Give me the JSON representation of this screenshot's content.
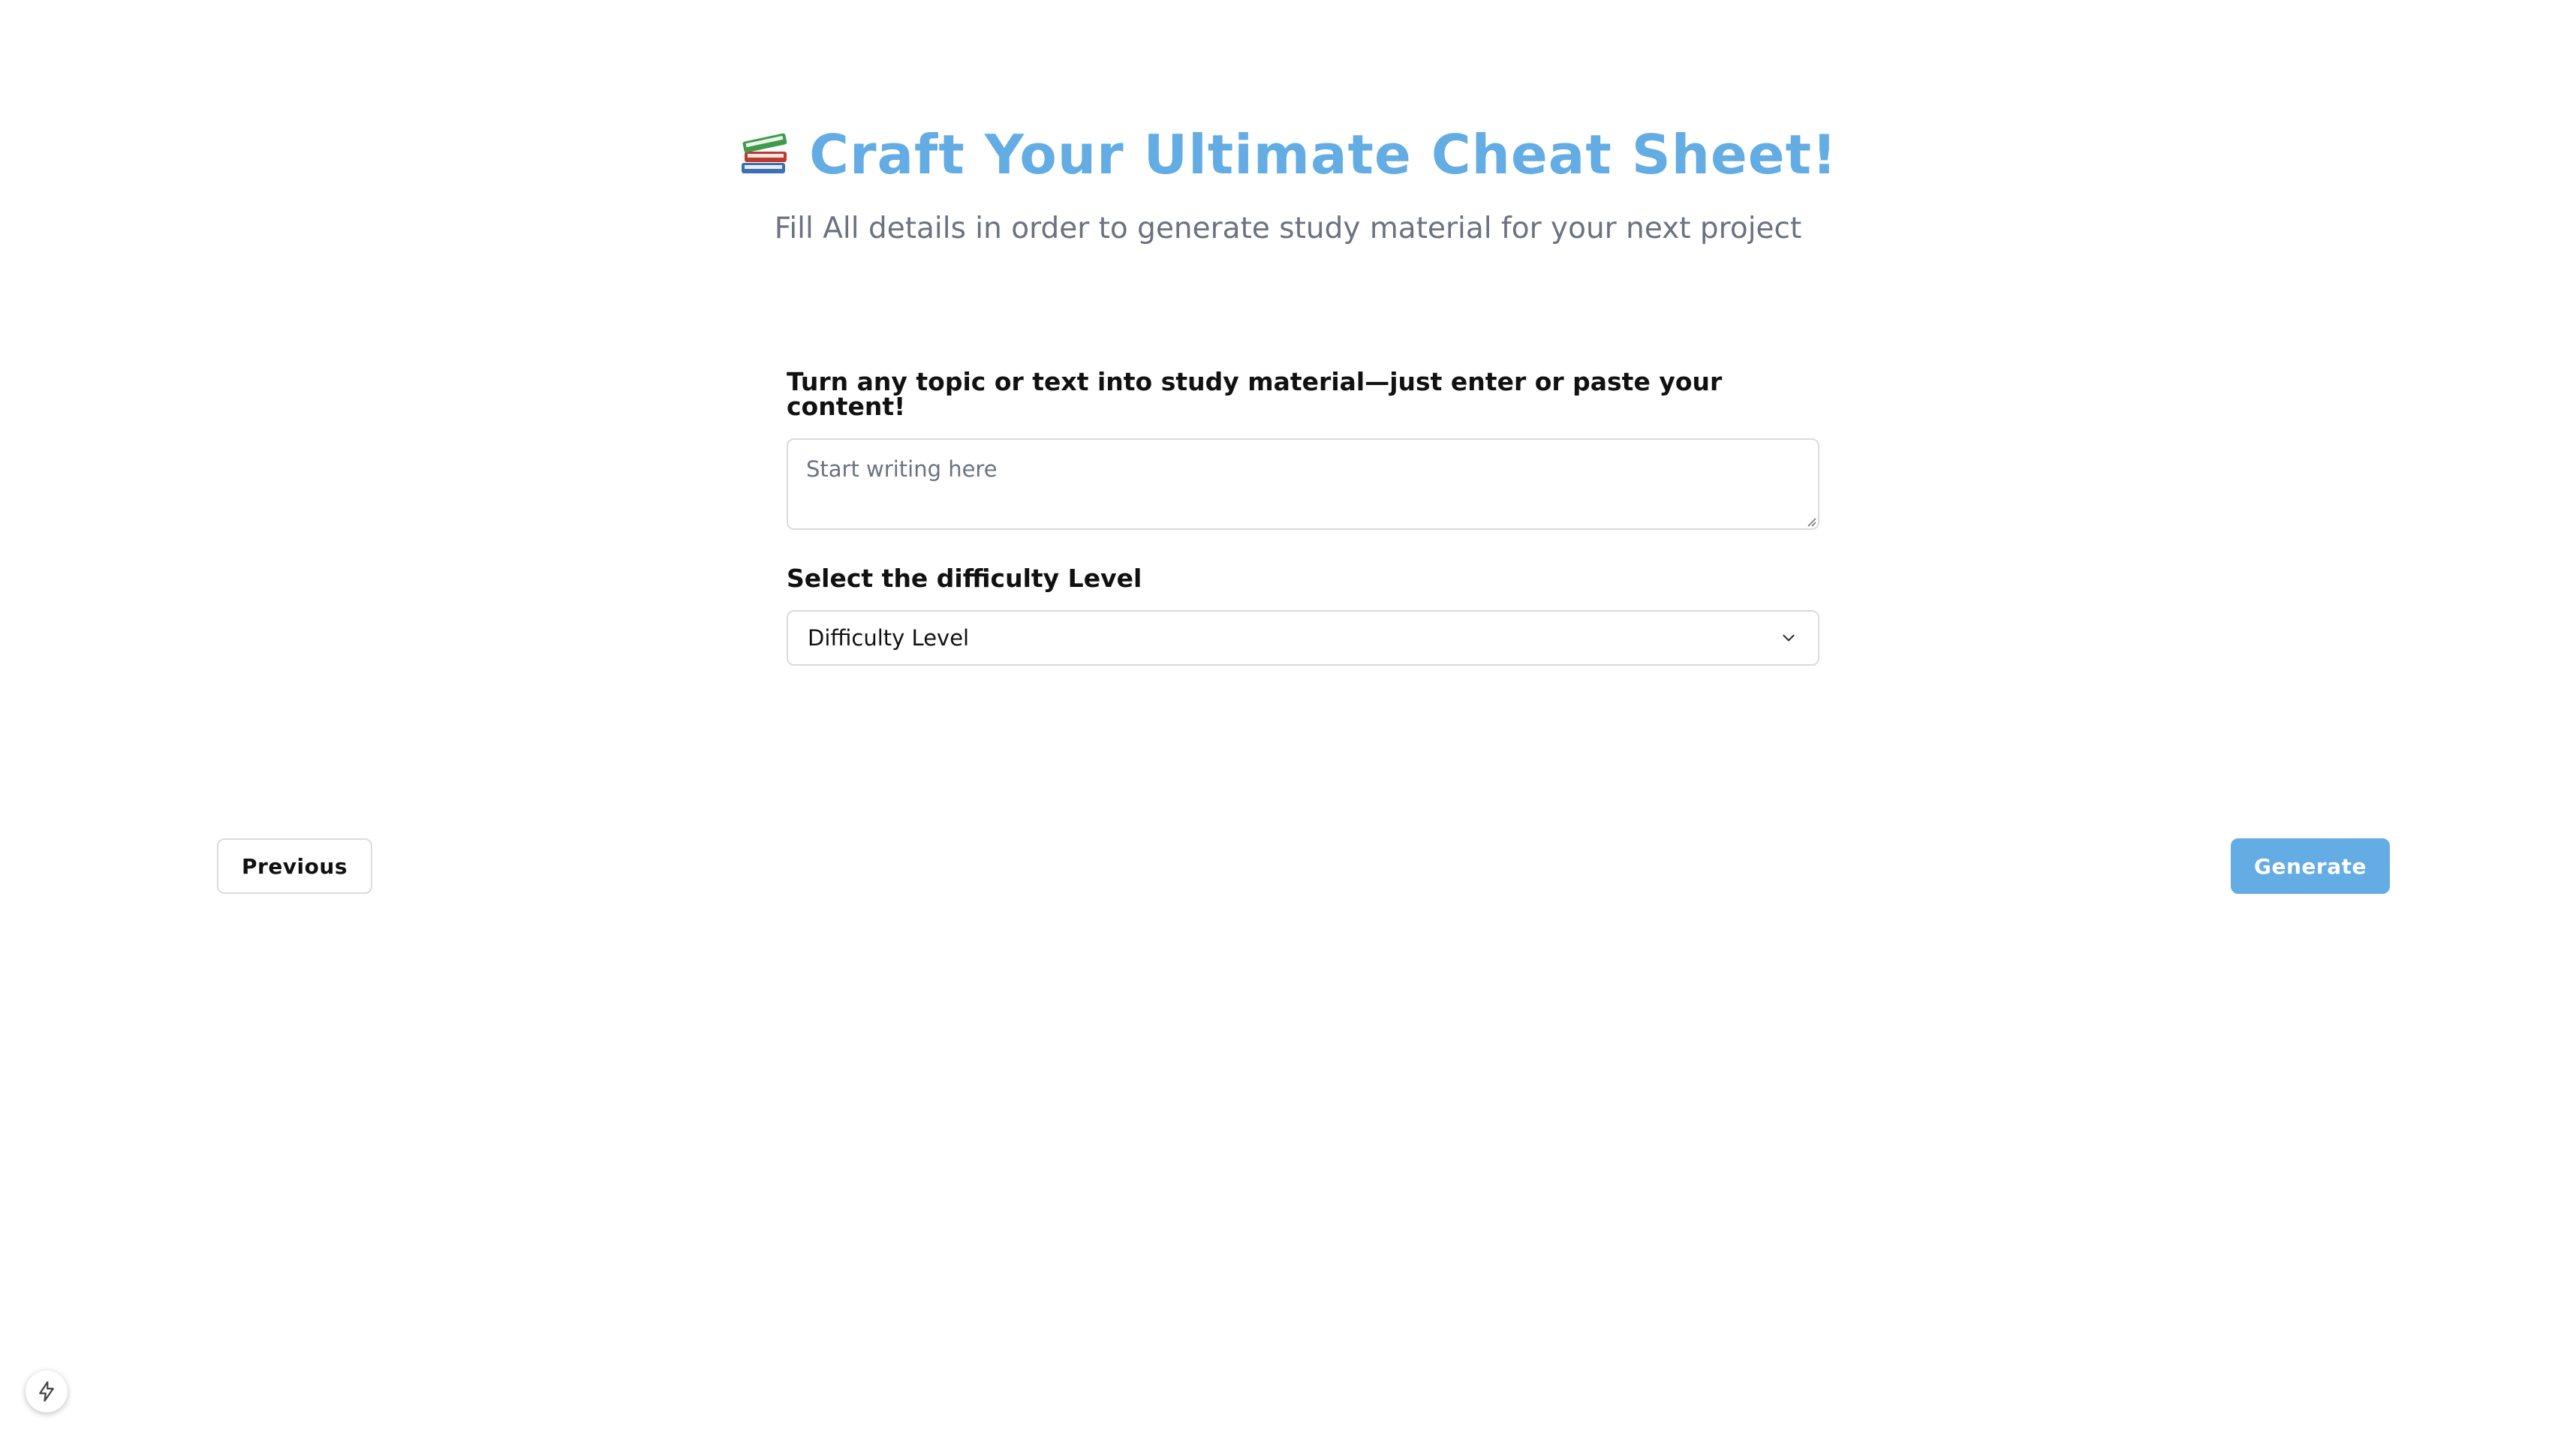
{
  "header": {
    "icon": "books-icon",
    "title": "Craft Your Ultimate Cheat Sheet!",
    "subtitle": "Fill All details in order to generate study material for your next project"
  },
  "form": {
    "content_label": "Turn any topic or text into study material—just enter or paste your content!",
    "content_placeholder": "Start writing here",
    "content_value": "",
    "difficulty_label": "Select the difficulty Level",
    "difficulty_selected": "Difficulty Level"
  },
  "navigation": {
    "previous_label": "Previous",
    "generate_label": "Generate"
  },
  "colors": {
    "accent": "#63ace4",
    "subtitle": "#6b7280",
    "border": "#d8dbe0"
  },
  "badge": {
    "icon": "lightning-icon"
  }
}
